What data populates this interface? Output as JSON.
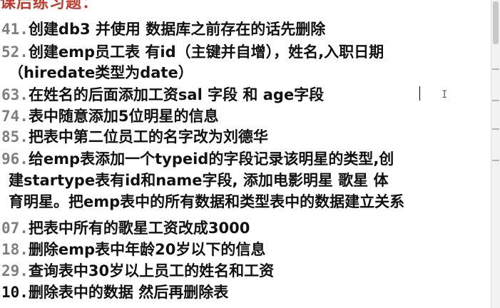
{
  "title": "课后练习题：",
  "lines": [
    {
      "num": "41.",
      "text": "创建db3 并使用 数据库之前存在的话先删除"
    },
    {
      "num": "52.",
      "text": "创建emp员工表 有id（主键并自增），姓名,入职日期"
    },
    {
      "num": "",
      "text": "（hiredate类型为date）"
    },
    {
      "num": "63.",
      "text": "在姓名的后面添加工资sal 字段 和 age字段"
    },
    {
      "num": "74.",
      "text": "表中随意添加5位明星的信息"
    },
    {
      "num": "85.",
      "text": "把表中第二位员工的名字改为刘德华"
    },
    {
      "num": "96.",
      "text": "给emp表添加一个typeid的字段记录该明星的类型,创"
    },
    {
      "num": "",
      "text": "建startype表有id和name字段, 添加电影明星 歌星 体"
    },
    {
      "num": "",
      "text": "育明星。把emp表中的所有数据和类型表中的数据建立关系"
    },
    {
      "num": "07.",
      "text": "把表中所有的歌星工资改成3000"
    },
    {
      "num": "18.",
      "text": "删除emp表中年龄20岁以下的信息"
    },
    {
      "num": "29.",
      "text": "查询表中30岁以上员工的姓名和工资"
    },
    {
      "num": "10.",
      "text": "删除表中的数据 然后再删除表"
    }
  ]
}
